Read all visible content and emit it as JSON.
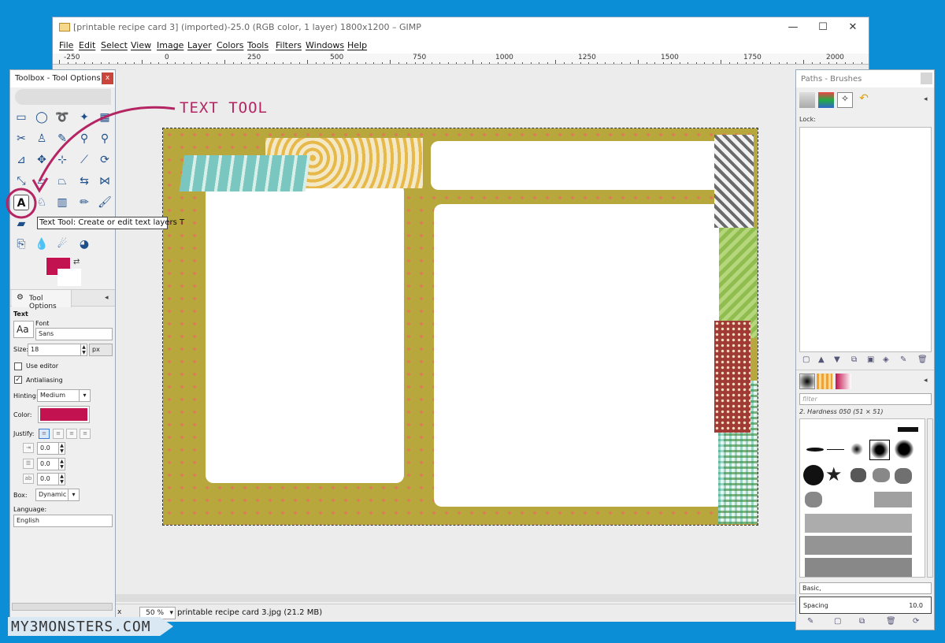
{
  "window": {
    "title": "[printable recipe card 3] (imported)-25.0 (RGB color, 1 layer) 1800x1200 – GIMP",
    "controls": {
      "minimize": "—",
      "maximize": "☐",
      "close": "✕"
    }
  },
  "menu": [
    "File",
    "Edit",
    "Select",
    "View",
    "Image",
    "Layer",
    "Colors",
    "Tools",
    "Filters",
    "Windows",
    "Help"
  ],
  "ruler": [
    "-250",
    "0",
    "250",
    "500",
    "750",
    "1000",
    "1250",
    "1500",
    "1750",
    "2000"
  ],
  "status": {
    "unit": "x",
    "zoom": "50 %",
    "file": "printable recipe card 3.jpg (21.2 MB)"
  },
  "annotation": {
    "label": "TEXT TOOL",
    "color": "#b52463"
  },
  "toolbox": {
    "title": "Toolbox - Tool Options",
    "close": "x",
    "tooltip": "Text Tool: Create or edit text layers  T",
    "fg_color": "#c2124f",
    "tool_options_tab": "Tool Options",
    "tab_menu": "◂",
    "options": {
      "text_heading": "Text",
      "font_label": "Font",
      "font_value": "Sans",
      "size_label": "Size:",
      "size_value": "18",
      "size_unit": "px",
      "use_editor": "Use editor",
      "antialiasing": "Antialiasing",
      "hinting_label": "Hinting:",
      "hinting_value": "Medium",
      "color_label": "Color:",
      "justify_label": "Justify:",
      "indent_value": "0.0",
      "line_spacing_value": "0.0",
      "letter_spacing_value": "0.0",
      "box_label": "Box:",
      "box_value": "Dynamic",
      "language_label": "Language:",
      "language_value": "English"
    }
  },
  "dock": {
    "title": "Paths - Brushes",
    "lock_label": "Lock:",
    "filter_placeholder": "filter",
    "brush_name": "2. Hardness 050 (51 × 51)",
    "preset": "Basic,",
    "spacing_label": "Spacing",
    "spacing_value": "10.0"
  },
  "watermark": "MY3MONSTERS.COM"
}
